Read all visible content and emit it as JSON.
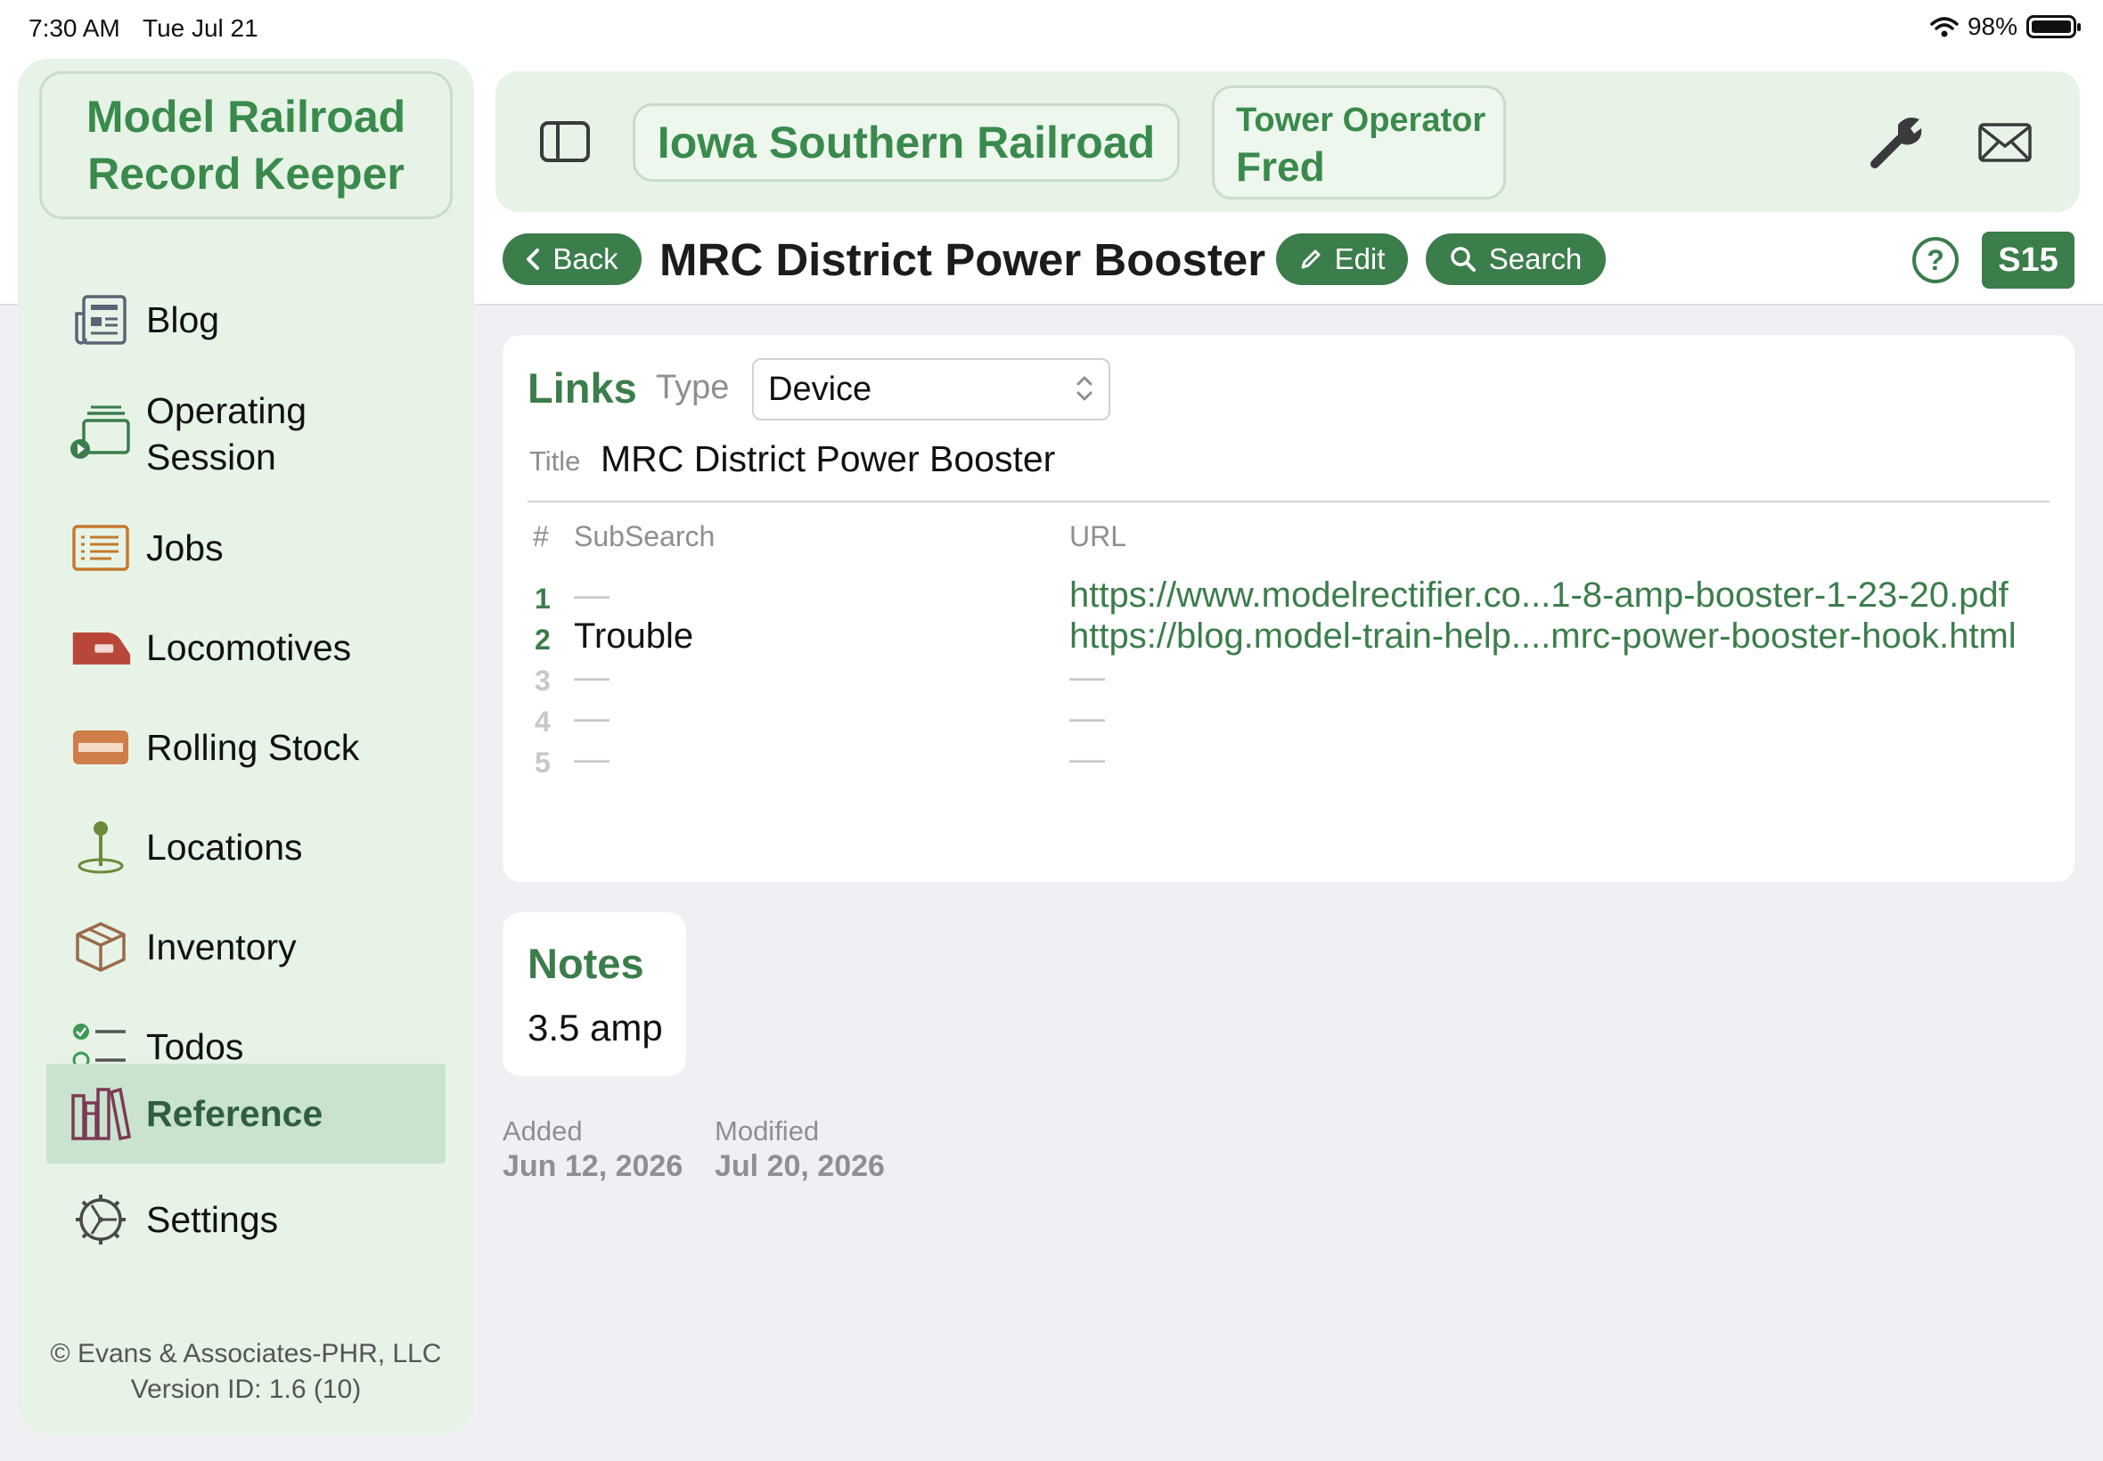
{
  "status_bar": {
    "time": "7:30 AM",
    "date": "Tue Jul 21",
    "battery": "98%"
  },
  "sidebar": {
    "app_title": [
      "Model Railroad",
      "Record Keeper"
    ],
    "items": [
      {
        "label": "Blog",
        "icon": "newspaper-icon",
        "selected": false
      },
      {
        "label": "Operating Session",
        "icon": "session-cards-icon",
        "selected": false
      },
      {
        "label": "Jobs",
        "icon": "list-rect-icon",
        "selected": false
      },
      {
        "label": "Locomotives",
        "icon": "locomotive-icon",
        "selected": false
      },
      {
        "label": "Rolling Stock",
        "icon": "rolling-stock-icon",
        "selected": false
      },
      {
        "label": "Locations",
        "icon": "map-pin-icon",
        "selected": false
      },
      {
        "label": "Inventory",
        "icon": "box-icon",
        "selected": false
      },
      {
        "label": "Todos",
        "icon": "checklist-icon",
        "selected": false
      },
      {
        "label": "Reference",
        "icon": "books-icon",
        "selected": true
      },
      {
        "label": "Settings",
        "icon": "gear-icon",
        "selected": false
      }
    ],
    "footer": {
      "copyright": "© Evans & Associates-PHR, LLC",
      "version": "Version ID: 1.6 (10)"
    }
  },
  "toolbar": {
    "railroad": "Iowa Southern Railroad",
    "operator_role": "Tower Operator",
    "operator_name": "Fred"
  },
  "title_row": {
    "back_label": "Back",
    "title": "MRC District Power Booster",
    "edit_label": "Edit",
    "search_label": "Search",
    "badge": "S15"
  },
  "links": {
    "heading": "Links",
    "type_label": "Type",
    "type_value": "Device",
    "title_label": "Title",
    "title_value": "MRC District Power Booster",
    "columns": {
      "num": "#",
      "subsearch": "SubSearch",
      "url": "URL"
    },
    "rows": [
      {
        "num": "1",
        "subsearch": "—",
        "url": "https://www.modelrectifier.co...1-8-amp-booster-1-23-20.pdf"
      },
      {
        "num": "2",
        "subsearch": "Trouble",
        "url": "https://blog.model-train-help....mrc-power-booster-hook.html"
      },
      {
        "num": "3",
        "subsearch": "—",
        "url": "—"
      },
      {
        "num": "4",
        "subsearch": "—",
        "url": "—"
      },
      {
        "num": "5",
        "subsearch": "—",
        "url": "—"
      }
    ]
  },
  "notes": {
    "heading": "Notes",
    "value": "3.5 amp"
  },
  "meta": {
    "added_label": "Added",
    "added_value": "Jun 12, 2026",
    "modified_label": "Modified",
    "modified_value": "Jul 20, 2026"
  },
  "colors": {
    "accent": "#3b7d4b",
    "sidebar_bg": "#e6f3e6",
    "selected_bg": "#c9e3cf"
  }
}
